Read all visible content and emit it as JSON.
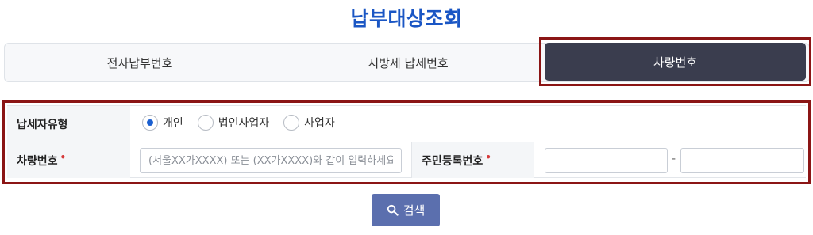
{
  "page": {
    "title": "납부대상조회"
  },
  "tabs": [
    {
      "label": "전자납부번호"
    },
    {
      "label": "지방세 납세번호"
    },
    {
      "label": "차량번호",
      "active": true
    }
  ],
  "form": {
    "taxpayer_type": {
      "label": "납세자유형",
      "options": [
        "개인",
        "법인사업자",
        "사업자"
      ],
      "selected": "개인"
    },
    "car_number": {
      "label": "차량번호",
      "required_mark": "•",
      "value": "",
      "placeholder": "(서울XX가XXXX) 또는 (XX가XXXX)와 같이 입력하세요"
    },
    "resident_number": {
      "label": "주민등록번호",
      "required_mark": "•",
      "separator": "-",
      "part1": "",
      "part2": ""
    }
  },
  "search_button": {
    "label": "검색",
    "icon": "search-icon"
  },
  "colors": {
    "title": "#1a56c4",
    "active_tab": "#3a3d4e",
    "highlight_border": "#8b1515",
    "button": "#5b6fae",
    "radio": "#1a5fd0"
  }
}
